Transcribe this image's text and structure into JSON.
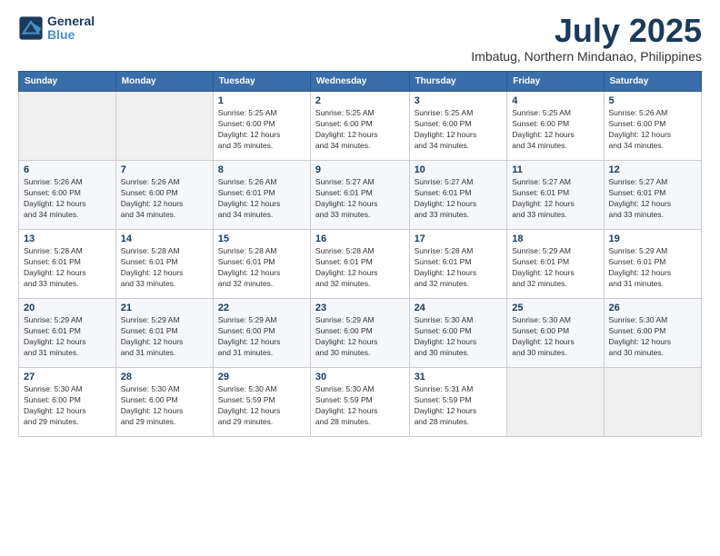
{
  "header": {
    "logo_line1": "General",
    "logo_line2": "Blue",
    "month": "July 2025",
    "location": "Imbatug, Northern Mindanao, Philippines"
  },
  "weekdays": [
    "Sunday",
    "Monday",
    "Tuesday",
    "Wednesday",
    "Thursday",
    "Friday",
    "Saturday"
  ],
  "weeks": [
    [
      {
        "day": "",
        "info": ""
      },
      {
        "day": "",
        "info": ""
      },
      {
        "day": "1",
        "info": "Sunrise: 5:25 AM\nSunset: 6:00 PM\nDaylight: 12 hours\nand 35 minutes."
      },
      {
        "day": "2",
        "info": "Sunrise: 5:25 AM\nSunset: 6:00 PM\nDaylight: 12 hours\nand 34 minutes."
      },
      {
        "day": "3",
        "info": "Sunrise: 5:25 AM\nSunset: 6:00 PM\nDaylight: 12 hours\nand 34 minutes."
      },
      {
        "day": "4",
        "info": "Sunrise: 5:25 AM\nSunset: 6:00 PM\nDaylight: 12 hours\nand 34 minutes."
      },
      {
        "day": "5",
        "info": "Sunrise: 5:26 AM\nSunset: 6:00 PM\nDaylight: 12 hours\nand 34 minutes."
      }
    ],
    [
      {
        "day": "6",
        "info": "Sunrise: 5:26 AM\nSunset: 6:00 PM\nDaylight: 12 hours\nand 34 minutes."
      },
      {
        "day": "7",
        "info": "Sunrise: 5:26 AM\nSunset: 6:00 PM\nDaylight: 12 hours\nand 34 minutes."
      },
      {
        "day": "8",
        "info": "Sunrise: 5:26 AM\nSunset: 6:01 PM\nDaylight: 12 hours\nand 34 minutes."
      },
      {
        "day": "9",
        "info": "Sunrise: 5:27 AM\nSunset: 6:01 PM\nDaylight: 12 hours\nand 33 minutes."
      },
      {
        "day": "10",
        "info": "Sunrise: 5:27 AM\nSunset: 6:01 PM\nDaylight: 12 hours\nand 33 minutes."
      },
      {
        "day": "11",
        "info": "Sunrise: 5:27 AM\nSunset: 6:01 PM\nDaylight: 12 hours\nand 33 minutes."
      },
      {
        "day": "12",
        "info": "Sunrise: 5:27 AM\nSunset: 6:01 PM\nDaylight: 12 hours\nand 33 minutes."
      }
    ],
    [
      {
        "day": "13",
        "info": "Sunrise: 5:28 AM\nSunset: 6:01 PM\nDaylight: 12 hours\nand 33 minutes."
      },
      {
        "day": "14",
        "info": "Sunrise: 5:28 AM\nSunset: 6:01 PM\nDaylight: 12 hours\nand 33 minutes."
      },
      {
        "day": "15",
        "info": "Sunrise: 5:28 AM\nSunset: 6:01 PM\nDaylight: 12 hours\nand 32 minutes."
      },
      {
        "day": "16",
        "info": "Sunrise: 5:28 AM\nSunset: 6:01 PM\nDaylight: 12 hours\nand 32 minutes."
      },
      {
        "day": "17",
        "info": "Sunrise: 5:28 AM\nSunset: 6:01 PM\nDaylight: 12 hours\nand 32 minutes."
      },
      {
        "day": "18",
        "info": "Sunrise: 5:29 AM\nSunset: 6:01 PM\nDaylight: 12 hours\nand 32 minutes."
      },
      {
        "day": "19",
        "info": "Sunrise: 5:29 AM\nSunset: 6:01 PM\nDaylight: 12 hours\nand 31 minutes."
      }
    ],
    [
      {
        "day": "20",
        "info": "Sunrise: 5:29 AM\nSunset: 6:01 PM\nDaylight: 12 hours\nand 31 minutes."
      },
      {
        "day": "21",
        "info": "Sunrise: 5:29 AM\nSunset: 6:01 PM\nDaylight: 12 hours\nand 31 minutes."
      },
      {
        "day": "22",
        "info": "Sunrise: 5:29 AM\nSunset: 6:00 PM\nDaylight: 12 hours\nand 31 minutes."
      },
      {
        "day": "23",
        "info": "Sunrise: 5:29 AM\nSunset: 6:00 PM\nDaylight: 12 hours\nand 30 minutes."
      },
      {
        "day": "24",
        "info": "Sunrise: 5:30 AM\nSunset: 6:00 PM\nDaylight: 12 hours\nand 30 minutes."
      },
      {
        "day": "25",
        "info": "Sunrise: 5:30 AM\nSunset: 6:00 PM\nDaylight: 12 hours\nand 30 minutes."
      },
      {
        "day": "26",
        "info": "Sunrise: 5:30 AM\nSunset: 6:00 PM\nDaylight: 12 hours\nand 30 minutes."
      }
    ],
    [
      {
        "day": "27",
        "info": "Sunrise: 5:30 AM\nSunset: 6:00 PM\nDaylight: 12 hours\nand 29 minutes."
      },
      {
        "day": "28",
        "info": "Sunrise: 5:30 AM\nSunset: 6:00 PM\nDaylight: 12 hours\nand 29 minutes."
      },
      {
        "day": "29",
        "info": "Sunrise: 5:30 AM\nSunset: 5:59 PM\nDaylight: 12 hours\nand 29 minutes."
      },
      {
        "day": "30",
        "info": "Sunrise: 5:30 AM\nSunset: 5:59 PM\nDaylight: 12 hours\nand 28 minutes."
      },
      {
        "day": "31",
        "info": "Sunrise: 5:31 AM\nSunset: 5:59 PM\nDaylight: 12 hours\nand 28 minutes."
      },
      {
        "day": "",
        "info": ""
      },
      {
        "day": "",
        "info": ""
      }
    ]
  ]
}
